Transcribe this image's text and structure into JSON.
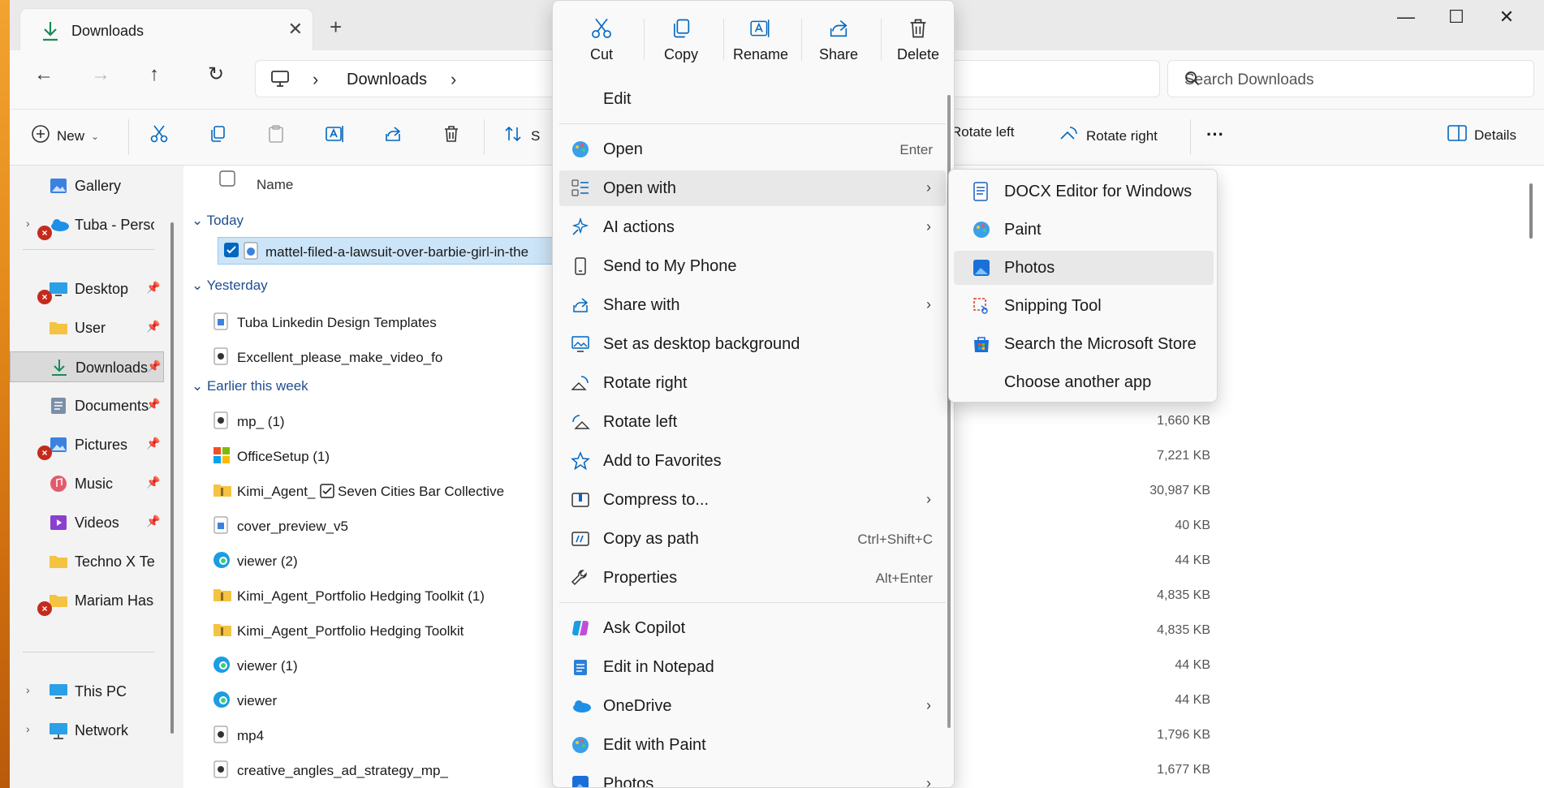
{
  "window": {
    "tab_title": "Downloads",
    "search_placeholder": "Search Downloads",
    "breadcrumb": [
      "Downloads"
    ]
  },
  "command_bar": {
    "new_label": "New",
    "sort_label_partial": "S",
    "rotate_left": "Rotate left",
    "rotate_right": "Rotate right",
    "details": "Details"
  },
  "sidebar": {
    "items": [
      {
        "label": "Gallery"
      },
      {
        "label": "Tuba - Personal"
      },
      {
        "label": "Desktop"
      },
      {
        "label": "User"
      },
      {
        "label": "Downloads"
      },
      {
        "label": "Documents"
      },
      {
        "label": "Pictures"
      },
      {
        "label": "Music"
      },
      {
        "label": "Videos"
      },
      {
        "label": "Techno X Test"
      },
      {
        "label": "Mariam Hassan"
      },
      {
        "label": "This PC"
      },
      {
        "label": "Network"
      }
    ]
  },
  "file_list": {
    "column_name": "Name",
    "groups": [
      "Today",
      "Yesterday",
      "Earlier this week"
    ],
    "files": [
      {
        "name": "mattel-filed-a-lawsuit-over-barbie-girl-in-the",
        "size": ""
      },
      {
        "name": "Tuba Linkedin Design Templates",
        "size": ""
      },
      {
        "name": "Excellent_please_make_video_fo",
        "size": ""
      },
      {
        "name": "mp_ (1)",
        "size": "1,660 KB"
      },
      {
        "name": "OfficeSetup (1)",
        "size": "7,221 KB"
      },
      {
        "name": "Kimi_Agent_",
        "name_tail": "Seven Cities Bar Collective",
        "size": "30,987 KB"
      },
      {
        "name": "cover_preview_v5",
        "size": "40 KB"
      },
      {
        "name": "viewer (2)",
        "size": "44 KB"
      },
      {
        "name": "Kimi_Agent_Portfolio Hedging Toolkit (1)",
        "size": "4,835 KB"
      },
      {
        "name": "Kimi_Agent_Portfolio Hedging Toolkit",
        "size": "4,835 KB"
      },
      {
        "name": "viewer (1)",
        "size": "44 KB"
      },
      {
        "name": "viewer",
        "size": "44 KB"
      },
      {
        "name": "mp4",
        "size": "1,796 KB"
      },
      {
        "name": "creative_angles_ad_strategy_mp_",
        "size": "1,677 KB"
      }
    ]
  },
  "context_menu": {
    "quick_actions": [
      {
        "label": "Cut",
        "icon": "cut-icon"
      },
      {
        "label": "Copy",
        "icon": "copy-icon"
      },
      {
        "label": "Rename",
        "icon": "rename-icon"
      },
      {
        "label": "Share",
        "icon": "share-icon"
      },
      {
        "label": "Delete",
        "icon": "delete-icon"
      }
    ],
    "items": [
      {
        "label": "Edit"
      },
      {
        "label": "Open",
        "shortcut": "Enter"
      },
      {
        "label": "Open with"
      },
      {
        "label": "AI actions"
      },
      {
        "label": "Send to My Phone"
      },
      {
        "label": "Share with"
      },
      {
        "label": "Set as desktop background"
      },
      {
        "label": "Rotate right"
      },
      {
        "label": "Rotate left"
      },
      {
        "label": "Add to Favorites"
      },
      {
        "label": "Compress to..."
      },
      {
        "label": "Copy as path",
        "shortcut": "Ctrl+Shift+C"
      },
      {
        "label": "Properties",
        "shortcut": "Alt+Enter"
      },
      {
        "label": "Ask Copilot"
      },
      {
        "label": "Edit in Notepad"
      },
      {
        "label": "OneDrive"
      },
      {
        "label": "Edit with Paint"
      },
      {
        "label": "Photos"
      }
    ]
  },
  "open_with_submenu": {
    "items": [
      {
        "label": "DOCX Editor for Windows"
      },
      {
        "label": "Paint"
      },
      {
        "label": "Photos"
      },
      {
        "label": "Snipping Tool"
      },
      {
        "label": "Search the Microsoft Store"
      },
      {
        "label": "Choose another app"
      }
    ]
  },
  "colors": {
    "accent": "#0067c0",
    "selection": "#cce4f7",
    "error": "#c42b1c",
    "folder": "#f5c342"
  }
}
